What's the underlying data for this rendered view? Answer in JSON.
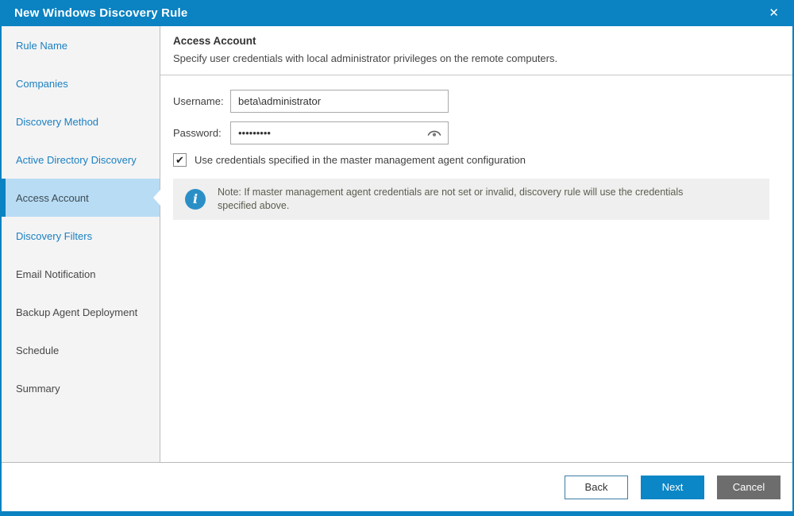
{
  "window": {
    "title": "New Windows Discovery Rule",
    "close_glyph": "✕"
  },
  "sidebar": {
    "items": [
      {
        "label": "Rule Name",
        "state": "done"
      },
      {
        "label": "Companies",
        "state": "done"
      },
      {
        "label": "Discovery Method",
        "state": "done"
      },
      {
        "label": "Active Directory Discovery",
        "state": "done"
      },
      {
        "label": "Access Account",
        "state": "active"
      },
      {
        "label": "Discovery Filters",
        "state": "done"
      },
      {
        "label": "Email Notification",
        "state": "pending"
      },
      {
        "label": "Backup Agent Deployment",
        "state": "pending"
      },
      {
        "label": "Schedule",
        "state": "pending"
      },
      {
        "label": "Summary",
        "state": "pending"
      }
    ]
  },
  "main": {
    "heading": "Access Account",
    "description": "Specify user credentials with local administrator privileges on the remote computers."
  },
  "form": {
    "username_label": "Username:",
    "username_value": "beta\\administrator",
    "password_label": "Password:",
    "password_value": "•••••••••",
    "checkbox_label": "Use credentials specified in the master management agent configuration",
    "checkbox_checked": true,
    "check_glyph": "✔"
  },
  "note": {
    "icon_glyph": "i",
    "text": "Note: If master management agent credentials are not set or invalid, discovery rule will use the credentials specified above."
  },
  "footer": {
    "back_label": "Back",
    "next_label": "Next",
    "cancel_label": "Cancel"
  },
  "colors": {
    "titlebar": "#0b82c1",
    "accent": "#0b82c1",
    "selected_item_bg": "#b8dcf4",
    "sidebar_bg": "#f4f4f5",
    "next_button": "#0b86c6",
    "cancel_button": "#6d6d6d",
    "note_bg": "#efefef",
    "info_icon": "#2b8fc7"
  }
}
